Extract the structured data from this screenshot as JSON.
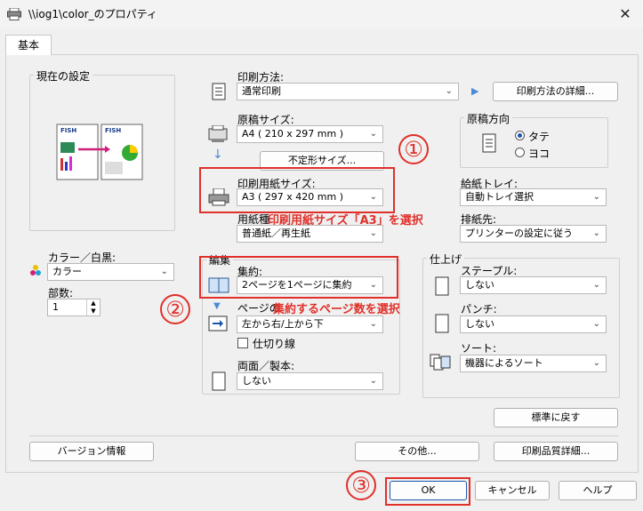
{
  "window": {
    "title": "\\\\iog1\\color_のプロパティ",
    "close_glyph": "✕"
  },
  "tab": {
    "label": "基本"
  },
  "current_settings": {
    "legend": "現在の設定"
  },
  "print_method": {
    "label": "印刷方法:",
    "value": "通常印刷",
    "details_button": "印刷方法の詳細..."
  },
  "original_size": {
    "label": "原稿サイズ:",
    "value": "A4 ( 210 x 297 mm )",
    "irregular_button": "不定形サイズ..."
  },
  "orientation": {
    "legend": "原稿方向",
    "options": [
      "タテ",
      "ヨコ"
    ],
    "selected": "タテ"
  },
  "paper_size": {
    "label": "印刷用紙サイズ:",
    "value": "A3 ( 297 x 420 mm )"
  },
  "paper_type": {
    "label": "用紙種",
    "value": "普通紙／再生紙"
  },
  "feed_tray": {
    "label": "給紙トレイ:",
    "value": "自動トレイ選択"
  },
  "output_tray": {
    "label": "排紙先:",
    "value": "プリンターの設定に従う"
  },
  "color_mode": {
    "label": "カラー／白黒:",
    "value": "カラー"
  },
  "copies": {
    "label": "部数:",
    "value": "1"
  },
  "edit": {
    "legend": "編集",
    "nup_label": "集約:",
    "nup_value": "2ページを1ページに集約",
    "order_label": "ページの",
    "order_value": "左から右/上から下",
    "separator_label": "仕切り線",
    "duplex_label": "両面／製本:",
    "duplex_value": "しない"
  },
  "finishing": {
    "legend": "仕上げ",
    "staple_label": "ステープル:",
    "staple_value": "しない",
    "punch_label": "パンチ:",
    "punch_value": "しない",
    "sort_label": "ソート:",
    "sort_value": "機器によるソート"
  },
  "buttons": {
    "restore": "標準に戻す",
    "version": "バージョン情報",
    "other": "その他...",
    "quality": "印刷品質詳細...",
    "ok": "OK",
    "cancel": "キャンセル",
    "help": "ヘルプ"
  },
  "annotations": {
    "marker1": "①",
    "note1": "印刷用紙サイズ「A3」を選択",
    "marker2": "②",
    "note2": "集約するページ数を選択",
    "marker3": "③"
  },
  "accent_color": "#e0302a"
}
